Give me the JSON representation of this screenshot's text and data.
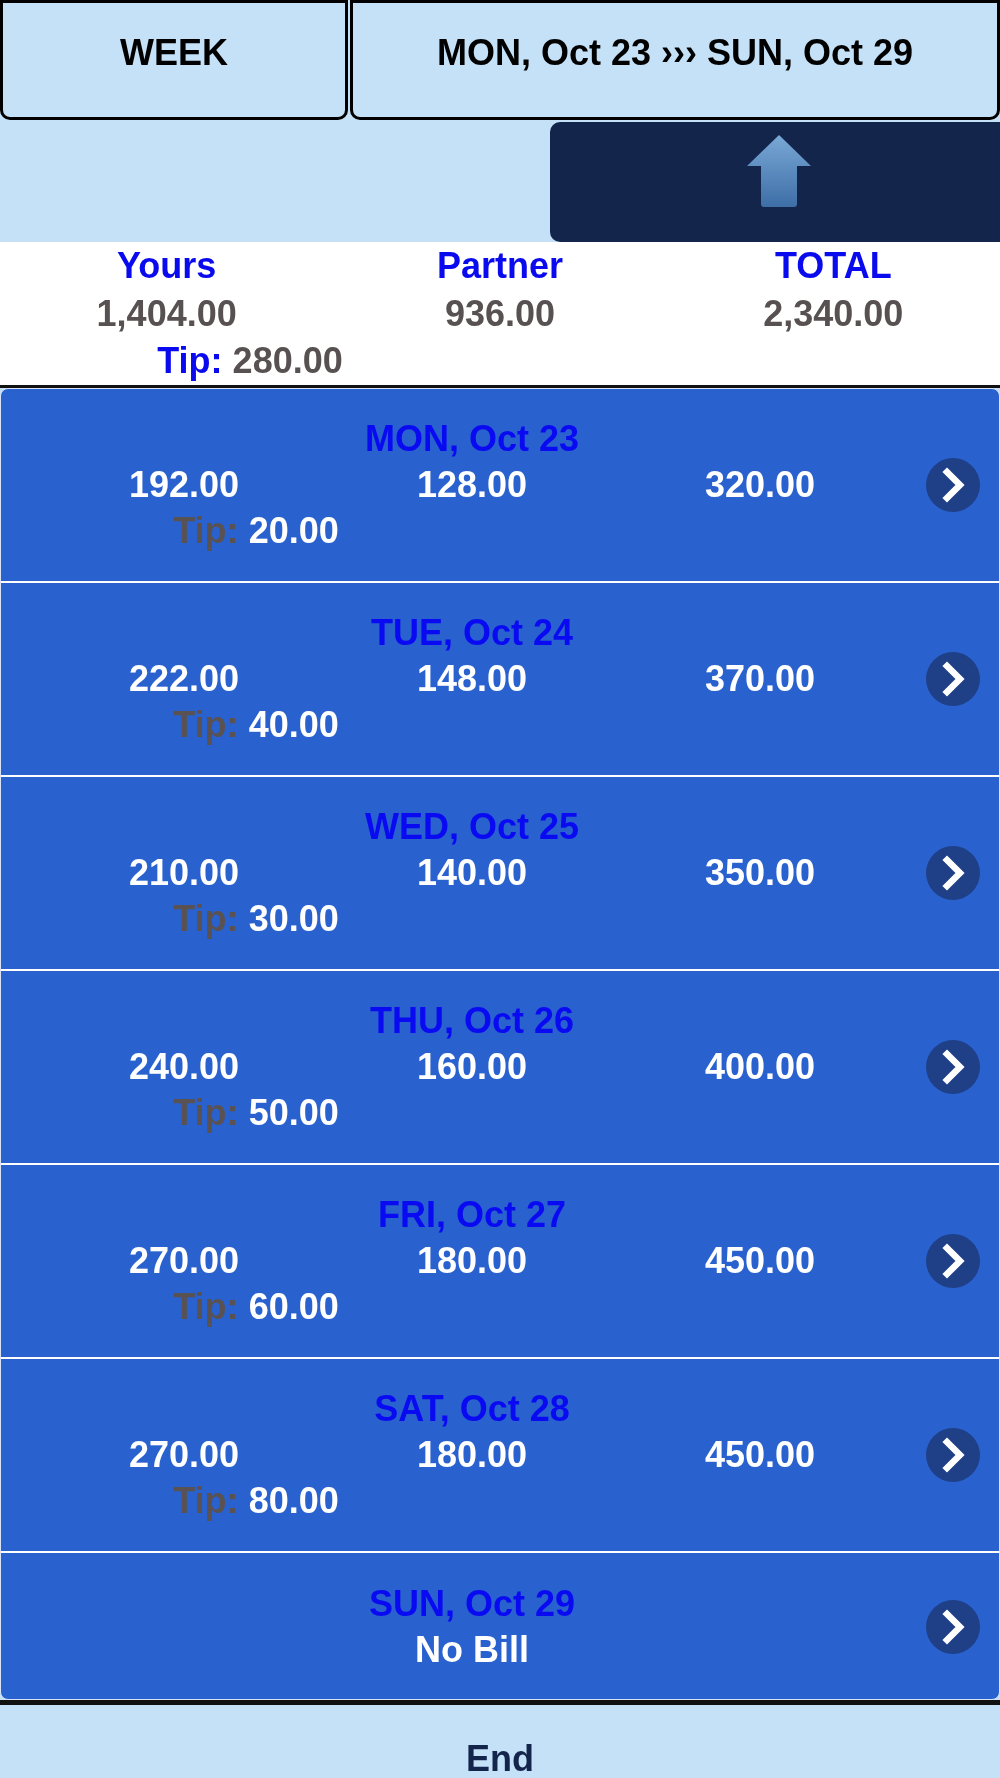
{
  "header": {
    "period_button": "WEEK",
    "range_button": "MON, Oct 23 ››› SUN, Oct 29"
  },
  "summary": {
    "columns": [
      {
        "label": "Yours",
        "value": "1,404.00"
      },
      {
        "label": "Partner",
        "value": "936.00"
      },
      {
        "label": "TOTAL",
        "value": "2,340.00"
      }
    ],
    "tip": {
      "label": "Tip:",
      "value": "280.00"
    }
  },
  "days": [
    {
      "kind": "bill",
      "date": "MON, Oct 23",
      "yours": "192.00",
      "partner": "128.00",
      "total": "320.00",
      "tip_label": "Tip:",
      "tip": "20.00"
    },
    {
      "kind": "bill",
      "date": "TUE, Oct 24",
      "yours": "222.00",
      "partner": "148.00",
      "total": "370.00",
      "tip_label": "Tip:",
      "tip": "40.00"
    },
    {
      "kind": "bill",
      "date": "WED, Oct 25",
      "yours": "210.00",
      "partner": "140.00",
      "total": "350.00",
      "tip_label": "Tip:",
      "tip": "30.00"
    },
    {
      "kind": "bill",
      "date": "THU, Oct 26",
      "yours": "240.00",
      "partner": "160.00",
      "total": "400.00",
      "tip_label": "Tip:",
      "tip": "50.00"
    },
    {
      "kind": "bill",
      "date": "FRI, Oct 27",
      "yours": "270.00",
      "partner": "180.00",
      "total": "450.00",
      "tip_label": "Tip:",
      "tip": "60.00"
    },
    {
      "kind": "bill",
      "date": "SAT, Oct 28",
      "yours": "270.00",
      "partner": "180.00",
      "total": "450.00",
      "tip_label": "Tip:",
      "tip": "80.00"
    },
    {
      "kind": "no_bill",
      "date": "SUN, Oct 29",
      "status": "No Bill"
    }
  ],
  "footer": {
    "label": "End"
  }
}
